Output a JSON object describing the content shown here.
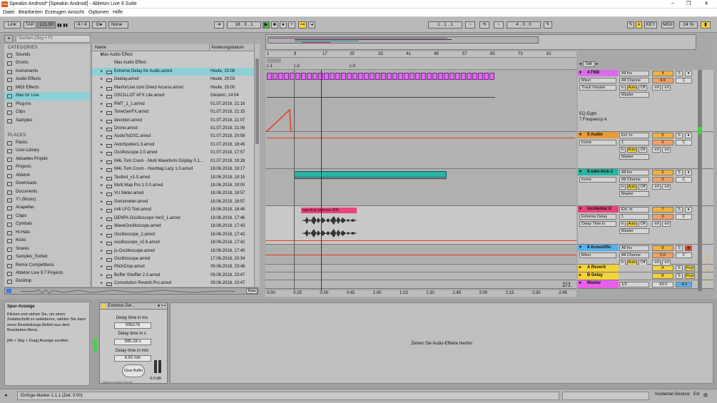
{
  "window": {
    "title": "Speakin Android*  [Speakin Android] - Ableton Live 9 Suite",
    "icon_label": "Live",
    "minimize": "–",
    "maximize": "❐",
    "close": "✕"
  },
  "menu": [
    "Datei",
    "Bearbeiten",
    "Erzeugen",
    "Ansicht",
    "Optionen",
    "Hilfe"
  ],
  "control_bar": {
    "link": "Link",
    "tap": "TAP",
    "tempo": "121.00",
    "signature": "4 / 4",
    "metro": "O●",
    "quantize": "None",
    "position": [
      "16",
      "3",
      "1"
    ],
    "loop_start": [
      "1",
      "1",
      "1"
    ],
    "loop_length": [
      "4",
      "0",
      "0"
    ],
    "key": "KEY",
    "midi": "MIDI",
    "cpu": "14 %",
    "d": "D"
  },
  "browser": {
    "search_placeholder": "Suchen (Strg + F)",
    "categories_header": "CATEGORIES",
    "categories": [
      {
        "label": "Sounds",
        "selected": false
      },
      {
        "label": "Drums",
        "selected": false
      },
      {
        "label": "Instruments",
        "selected": false
      },
      {
        "label": "Audio Effects",
        "selected": false
      },
      {
        "label": "MIDI Effects",
        "selected": false
      },
      {
        "label": "Max for Live",
        "selected": true
      },
      {
        "label": "Plug-ins",
        "selected": false
      },
      {
        "label": "Clips",
        "selected": false
      },
      {
        "label": "Samples",
        "selected": false
      }
    ],
    "places_header": "PLACES",
    "places": [
      "Packs",
      "User-Library",
      "Aktuelles Projekt",
      "Projects",
      "Ableton",
      "Downloads",
      "Documents",
      "Y:\\ (Music)",
      "Acapellas",
      "Claps",
      "Cymbals",
      "Hi-Hats",
      "Kicks",
      "Snares",
      "Samples_Sorted",
      "Remix Competitions",
      "Ableton Live 9.7 Projects",
      "Desktop"
    ],
    "col_name": "Name",
    "col_date": "Änderungsdatum",
    "folder_rows": [
      {
        "name": "Max Audio Effect",
        "date": ""
      },
      {
        "name": "Max Audio Effect",
        "date": ""
      }
    ],
    "files": [
      {
        "name": "Extreme Delay for Audio.amxd",
        "date": "Heute, 20:06",
        "selected": true
      },
      {
        "name": "Deelay.amxd",
        "date": "Heute, 20:03"
      },
      {
        "name": "MaxforLive.com Direct Access.amxd",
        "date": "Heute, 15:00"
      },
      {
        "name": "OSCILLOT AFX Lite.amxd",
        "date": "Gestern, 14:04"
      },
      {
        "name": "RMT_1_1.amxd",
        "date": "01.07.2018, 21:16"
      },
      {
        "name": "ToneGenFX.amxd",
        "date": "01.07.2018, 21:15"
      },
      {
        "name": "devotion.amxd",
        "date": "01.07.2018, 21:07"
      },
      {
        "name": "Drone.amxd",
        "date": "01.07.2018, 21:06"
      },
      {
        "name": "AudioToOSC.amxd",
        "date": "01.07.2018, 20:58"
      },
      {
        "name": "AutoSputter1.3.amxd",
        "date": "01.07.2018, 18:45"
      },
      {
        "name": "Oscilloscope 2.0.amxd",
        "date": "01.07.2018, 17:57"
      },
      {
        "name": "M4L Tom Cosm - Multi Waveform Display 0.1...",
        "date": "01.07.2018, 19:28"
      },
      {
        "name": "M4L Tom Cosm - Hashtag Lazy 1.0.amxd",
        "date": "18.06.2018, 19:17"
      },
      {
        "name": "Textbot_v1.0.amxd",
        "date": "18.06.2018, 19:15"
      },
      {
        "name": "Multi Map Pro 1.0.0.amxd",
        "date": "18.06.2018, 19:00"
      },
      {
        "name": "VU Meter.amxd",
        "date": "18.06.2018, 18:57"
      },
      {
        "name": "Goniometer.amxd",
        "date": "18.06.2018, 18:57"
      },
      {
        "name": "m4l LFO Tool.amxd",
        "date": "18.06.2018, 18:48"
      },
      {
        "name": "DENPA Oscilloscope Ver3_1.amxd",
        "date": "18.06.2018, 17:46"
      },
      {
        "name": "WaveOscilloscope.amxd",
        "date": "18.06.2018, 17:43"
      },
      {
        "name": "Oscilloscope_2.amxd",
        "date": "18.06.2018, 17:42"
      },
      {
        "name": "oscilloscope_v2.6.amxd",
        "date": "18.06.2018, 17:42"
      },
      {
        "name": "jo.Oscilloscope.amxd",
        "date": "18.06.2018, 17:40"
      },
      {
        "name": "Oscilloscope.amxd",
        "date": "17.06.2018, 20:34"
      },
      {
        "name": "PitchDrop.amxd",
        "date": "09.06.2018, 23:48"
      },
      {
        "name": "Buffer Shuffler 2.0.amxd",
        "date": "09.06.2018, 23:47"
      },
      {
        "name": "Convolution Reverb Pro.amxd",
        "date": "09.06.2018, 23:47"
      }
    ],
    "preview_raw": "Raw"
  },
  "arrangement": {
    "bar_numbers": [
      "1",
      "9",
      "17",
      "25",
      "33",
      "41",
      "49",
      "57",
      "65",
      "73",
      "81"
    ],
    "set_label": "Set",
    "locators": [
      "1",
      "2",
      "3"
    ],
    "time_labels": [
      "0:00",
      "0:15",
      "0:30",
      "0:45",
      "1:00",
      "1:15",
      "1:30",
      "1:45",
      "2:00",
      "2:15",
      "2:30",
      "2:45"
    ],
    "zoom_label": "2/1",
    "clip_incidental": "spectral spheres 82b",
    "device_info": {
      "name": "EQ Eight",
      "param": "7 Frequency A"
    }
  },
  "tracks": [
    {
      "name": "4 FM8",
      "color": "#d96ce8",
      "in": "All Ins",
      "ch": "All Channe",
      "mixer": "Mixer",
      "param": "Track Volume",
      "out": "Master",
      "num": "4",
      "vol": "4.6",
      "pan": "C",
      "send1": "-inf",
      "send2": "-inf",
      "mon": [
        "In",
        "Auto",
        "Off"
      ]
    },
    {
      "name": "5 Audio",
      "color": "#e89a3a",
      "in": "Ext. In",
      "ch": "1",
      "mixer": "Keine",
      "param": "",
      "out": "Master",
      "num": "5",
      "vol": "0",
      "pan": "C",
      "send1": "-inf",
      "send2": "-inf",
      "mon": [
        "In",
        "Auto",
        "Off"
      ]
    },
    {
      "name": "6 edm-kick-1",
      "color": "#2ab5a0",
      "in": "All Ins",
      "ch": "All Channe",
      "mixer": "Keine",
      "param": "",
      "out": "Master",
      "num": "6",
      "vol": "0",
      "pan": "C",
      "send1": "-inf",
      "send2": "-inf",
      "mon": [
        "In",
        "Auto",
        "Off"
      ]
    },
    {
      "name": "Incidental G",
      "color": "#e8437a",
      "in": "Ext. In",
      "ch": "1",
      "mixer": "Extreme Delay",
      "param": "Delay Time in",
      "out": "Master",
      "num": "7",
      "vol": "0",
      "pan": "C",
      "send1": "-inf",
      "send2": "-inf",
      "mon": [
        "In",
        "Auto",
        "Off"
      ]
    },
    {
      "name": "8 Acoustific",
      "color": "#5ab0e8",
      "in": "All Ins",
      "ch": "All Channe",
      "mixer": "Mixer",
      "param": "",
      "out": "",
      "num": "8",
      "vol": "0.0",
      "pan": "C",
      "send1": "-inf",
      "send2": "-inf",
      "mon": [
        "In",
        "Auto",
        "Off"
      ]
    }
  ],
  "returns": [
    {
      "name": "A Reverb",
      "letter": "A",
      "post": "Post"
    },
    {
      "name": "B Delay",
      "letter": "B",
      "post": "Post"
    }
  ],
  "master": {
    "name": "Master",
    "out": "1/2",
    "vol": "-69.0",
    "pan": "-4.0"
  },
  "info_view": {
    "title": "Spur-Anzeige",
    "body": "Klicken und ziehen Sie, um einen Zeitabschnitt zu selektieren, wählen Sie dann einen Bearbeitungs-Befehl aus dem Bearbeiten-Menü.",
    "hint": "[Alt + Strg + Drag] Anzeige scrollen"
  },
  "device": {
    "name": "Extreme Del...",
    "p1_label": "Delay time in ms",
    "p1_value": "595276",
    "p2_label": "Delay time in s",
    "p2_value": "595.28 s",
    "p3_label": "Delay time in min",
    "p3_value": "9.92 min",
    "button": "Clear Buffer",
    "db": "0.0 dB",
    "credit": "Made by Robert Schulz"
  },
  "fx_drop_text": "Ziehen Sie Audio-Effekte hierhin",
  "status": {
    "text": "Einfüge-Marker 1.1.1 (Zeit: 0:00)",
    "track": "Incidental Gesture",
    "ext": "Ext"
  }
}
